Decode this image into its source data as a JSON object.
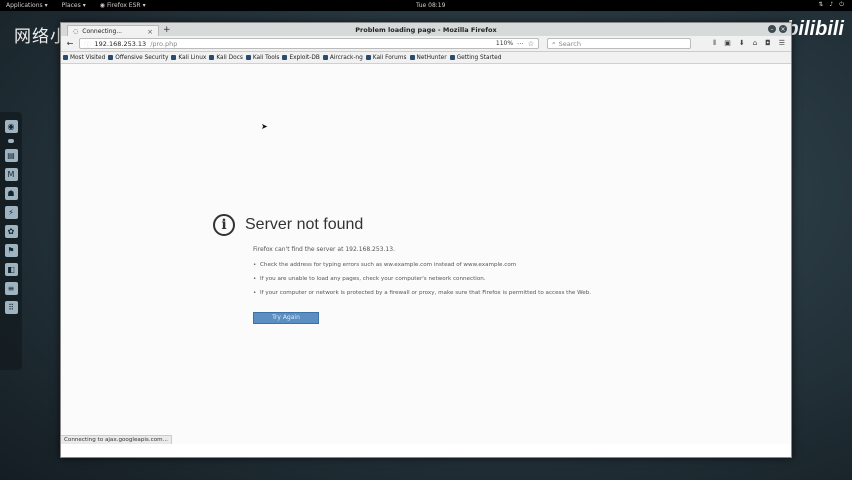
{
  "top_panel": {
    "applications": "Applications",
    "places": "Places",
    "active_app": "Firefox ESR",
    "clock": "Tue 08:19"
  },
  "watermarks": {
    "left": "网络小",
    "right": "bilibili"
  },
  "browser": {
    "window_title": "Problem loading page - Mozilla Firefox",
    "tab_label": "Connecting...",
    "url": "192.168.253.13",
    "url_suffix": "/pro.php",
    "zoom": "110%",
    "search_placeholder": "Search",
    "bookmarks": [
      "Most Visited",
      "Offensive Security",
      "Kali Linux",
      "Kali Docs",
      "Kali Tools",
      "Exploit-DB",
      "Aircrack-ng",
      "Kali Forums",
      "NetHunter",
      "Getting Started"
    ],
    "status": "Connecting to ajax.googleapis.com..."
  },
  "error_page": {
    "title": "Server not found",
    "description": "Firefox can't find the server at 192.168.253.13.",
    "suggestions": [
      "Check the address for typing errors such as ww.example.com instead of www.example.com",
      "If you are unable to load any pages, check your computer's network connection.",
      "If your computer or network is protected by a firewall or proxy, make sure that Firefox is permitted to access the Web."
    ],
    "button": "Try Again"
  }
}
